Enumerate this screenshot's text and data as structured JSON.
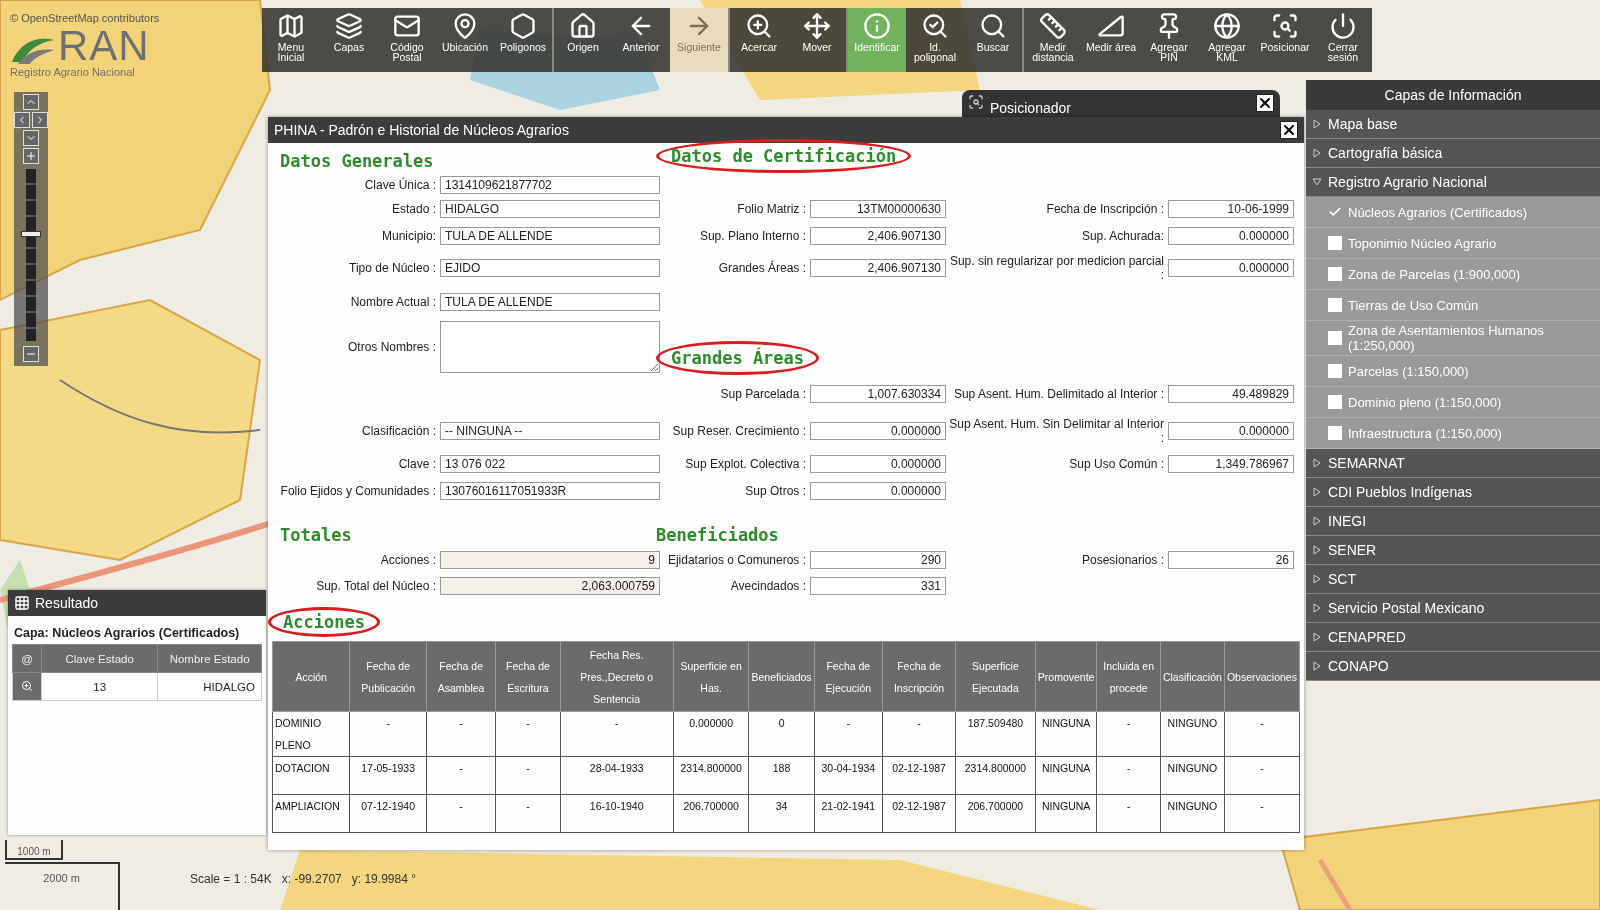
{
  "attribution": "© OpenStreetMap contributors",
  "logo": {
    "mark": "RAN",
    "subtitle": "Registro Agrario Nacional"
  },
  "toolbar": {
    "groups": [
      [
        {
          "label": "Menu Inicial",
          "selected": false,
          "disabled": false
        },
        {
          "label": "Capas",
          "selected": false,
          "disabled": false
        },
        {
          "label": "Código Postal",
          "selected": false,
          "disabled": false
        },
        {
          "label": "Ubicación",
          "selected": false,
          "disabled": false
        },
        {
          "label": "Poligonos",
          "selected": false,
          "disabled": false
        }
      ],
      [
        {
          "label": "Origen",
          "selected": false,
          "disabled": false
        },
        {
          "label": "Anterior",
          "selected": false,
          "disabled": false
        },
        {
          "label": "Siguiente",
          "selected": false,
          "disabled": true
        }
      ],
      [
        {
          "label": "Acercar",
          "selected": false,
          "disabled": false
        },
        {
          "label": "Mover",
          "selected": false,
          "disabled": false
        }
      ],
      [
        {
          "label": "Identificar",
          "selected": true,
          "disabled": false
        },
        {
          "label": "Id. poligonal",
          "selected": false,
          "disabled": false
        },
        {
          "label": "Buscar",
          "selected": false,
          "disabled": false
        }
      ],
      [
        {
          "label": "Medir distancia",
          "selected": false,
          "disabled": false
        },
        {
          "label": "Medir área",
          "selected": false,
          "disabled": false
        },
        {
          "label": "Agregar PIN",
          "selected": false,
          "disabled": false
        },
        {
          "label": "Agregar KML",
          "selected": false,
          "disabled": false
        },
        {
          "label": "Posicionar",
          "selected": false,
          "disabled": false
        },
        {
          "label": "Cerrar sesión",
          "selected": false,
          "disabled": false
        }
      ]
    ]
  },
  "map_controls": {
    "zoom": {
      "level": 0.62
    }
  },
  "scale": {
    "bar_small": "1000 m",
    "bar_large": "2000 m",
    "ratio": "Scale = 1 : 54K",
    "x": "x: -99.2707",
    "y": "y: 19.9984 °"
  },
  "posicionador": {
    "title": "Posicionador"
  },
  "dialog": {
    "title": "PHINA - Padrón e Historial de Núcleos Agrarios",
    "rows": [
      [
        {
          "kind": "heading",
          "text": "Datos Generales",
          "circled": false
        },
        {
          "kind": "heading",
          "text": "Datos de Certificación",
          "circled": true
        },
        null
      ],
      [
        {
          "kind": "text",
          "label": "Clave Única :",
          "value": "1314109621877702"
        },
        null,
        null
      ],
      [
        {
          "kind": "text",
          "label": "Estado :",
          "value": "HIDALGO"
        },
        {
          "kind": "number",
          "label": "Folio Matriz :",
          "value": "13TM00000630"
        },
        {
          "kind": "number",
          "label": "Fecha de Inscripción :",
          "value": "10-06-1999"
        }
      ],
      [
        {
          "kind": "text",
          "label": "Municipio:",
          "value": "TULA DE ALLENDE"
        },
        {
          "kind": "number",
          "label": "Sup. Plano Interno :",
          "value": "2,406.907130"
        },
        {
          "kind": "number",
          "label": "Sup. Achurada:",
          "value": "0.000000"
        }
      ],
      [
        {
          "kind": "text",
          "label": "Tipo de Núcleo :",
          "value": "EJIDO"
        },
        {
          "kind": "number",
          "label": "Grandes Áreas :",
          "value": "2,406.907130"
        },
        {
          "kind": "number",
          "label": "Sup. sin regularizar por medicion parcial :",
          "value": "0.000000"
        }
      ],
      [
        {
          "kind": "text",
          "label": "Nombre Actual :",
          "value": "TULA DE ALLENDE"
        },
        null,
        null
      ],
      [
        {
          "kind": "textarea",
          "label": "Otros Nombres :"
        },
        {
          "kind": "heading",
          "text": "Grandes Áreas",
          "circled": true
        },
        null
      ],
      [
        null,
        {
          "kind": "number",
          "label": "Sup Parcelada :",
          "value": "1,007.630334"
        },
        {
          "kind": "number",
          "label": "Sup Asent. Hum. Delimitado al Interior :",
          "value": "49.489829"
        }
      ],
      [
        {
          "kind": "text",
          "label": "Clasificación :",
          "value": "-- NINGUNA --"
        },
        {
          "kind": "number",
          "label": "Sup Reser. Crecimiento :",
          "value": "0.000000"
        },
        {
          "kind": "number",
          "label": "Sup Asent. Hum. Sin Delimitar al Interior :",
          "value": "0.000000"
        }
      ],
      [
        {
          "kind": "text",
          "label": "Clave :",
          "value": "13 076 022"
        },
        {
          "kind": "number",
          "label": "Sup Explot. Colectiva :",
          "value": "0.000000"
        },
        {
          "kind": "number",
          "label": "Sup Uso Común :",
          "value": "1,349.786967"
        }
      ],
      [
        {
          "kind": "text",
          "label": "Folio Ejidos y Comunidades :",
          "value": "13076016117051933R"
        },
        {
          "kind": "number",
          "label": "Sup Otros :",
          "value": "0.000000"
        },
        null
      ],
      [
        {
          "kind": "heading",
          "text": "Totales",
          "circled": false
        },
        {
          "kind": "heading",
          "text": "Beneficiados",
          "circled": false
        },
        null
      ],
      [
        {
          "kind": "locked",
          "label": "Acciones :",
          "value": "9"
        },
        {
          "kind": "number",
          "label": "Ejidatarios o Comuneros :",
          "value": "290"
        },
        {
          "kind": "number",
          "label": "Posesionarios :",
          "value": "26"
        }
      ],
      [
        {
          "kind": "locked",
          "label": "Sup. Total del Núcleo :",
          "value": "2,063.000759"
        },
        {
          "kind": "number",
          "label": "Avecindados :",
          "value": "331"
        },
        null
      ]
    ],
    "acciones": {
      "heading": "Acciones",
      "circled": true,
      "columns": [
        "Acción",
        "Fecha de Publicación",
        "Fecha de Asamblea",
        "Fecha de Escritura",
        "Fecha Res. Pres.,Decreto o Sentencia",
        "Superficie en Has.",
        "Beneficiados",
        "Fecha de Ejecución",
        "Fecha de Inscripción",
        "Superficie Ejecutada",
        "Promovente",
        "Incluida en procede",
        "Clasificación",
        "Observaciones"
      ],
      "rows": [
        [
          "DOMINIO PLENO",
          "-",
          "-",
          "-",
          "-",
          "0.000000",
          "0",
          "-",
          "-",
          "187.509480",
          "NINGUNA",
          "-",
          "NINGUNO",
          "-"
        ],
        [
          "DOTACION",
          "17-05-1933",
          "-",
          "-",
          "28-04-1933",
          "2314.800000",
          "188",
          "30-04-1934",
          "02-12-1987",
          "2314.800000",
          "NINGUNA",
          "-",
          "NINGUNO",
          "-"
        ],
        [
          "AMPLIACION",
          "07-12-1940",
          "-",
          "-",
          "16-10-1940",
          "206.700000",
          "34",
          "21-02-1941",
          "02-12-1987",
          "206.700000",
          "NINGUNA",
          "-",
          "NINGUNO",
          "-"
        ]
      ]
    }
  },
  "result_panel": {
    "title": "Resultado",
    "layer": "Capa: Núcleos Agrarios (Certificados)",
    "columns": [
      "@",
      "Clave Estado",
      "Nombre Estado"
    ],
    "rows": [
      [
        "",
        "13",
        "HIDALGO"
      ]
    ]
  },
  "layers": {
    "title": "Capas de Información",
    "groups": [
      {
        "label": "Mapa base",
        "expanded": false
      },
      {
        "label": "Cartografía básica",
        "expanded": false
      },
      {
        "label": "Registro Agrario Nacional",
        "expanded": true,
        "children": [
          {
            "label": "Núcleos Agrarios (Certificados)",
            "checked": true
          },
          {
            "label": "Toponimio Núcleo Agrario",
            "checked": false
          },
          {
            "label": "Zona de Parcelas (1:900,000)",
            "checked": false
          },
          {
            "label": "Tierras de Uso Común",
            "checked": false
          },
          {
            "label": "Zona de Asentamientos Humanos (1:250,000)",
            "checked": false
          },
          {
            "label": "Parcelas (1:150,000)",
            "checked": false
          },
          {
            "label": "Dominio pleno (1:150,000)",
            "checked": false
          },
          {
            "label": "Infraestructura (1:150,000)",
            "checked": false
          }
        ]
      },
      {
        "label": "SEMARNAT",
        "expanded": false
      },
      {
        "label": "CDI Pueblos Indígenas",
        "expanded": false
      },
      {
        "label": "INEGI",
        "expanded": false
      },
      {
        "label": "SENER",
        "expanded": false
      },
      {
        "label": "SCT",
        "expanded": false
      },
      {
        "label": "Servicio Postal Mexicano",
        "expanded": false
      },
      {
        "label": "CENAPRED",
        "expanded": false
      },
      {
        "label": "CONAPO",
        "expanded": false
      }
    ]
  }
}
